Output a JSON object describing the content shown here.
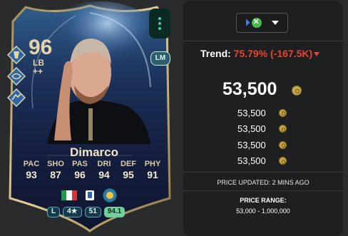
{
  "card": {
    "rating": "96",
    "position": "LB",
    "position_plus": "++",
    "alt_position": "LM",
    "name": "Dimarco",
    "stats": [
      {
        "label": "PAC",
        "value": "93"
      },
      {
        "label": "SHO",
        "value": "87"
      },
      {
        "label": "PAS",
        "value": "96"
      },
      {
        "label": "DRI",
        "value": "94"
      },
      {
        "label": "DEF",
        "value": "95"
      },
      {
        "label": "PHY",
        "value": "91"
      }
    ],
    "pills": {
      "foot": "L",
      "skill": "4★",
      "attr": "51",
      "chem": "94.1"
    },
    "nation_icon": "italy-flag-icon",
    "league_icon": "serie-a-icon",
    "club_icon": "club-crest-icon"
  },
  "panel": {
    "platform_icons": [
      "playstation-icon",
      "xbox-icon"
    ],
    "trend_label": "Trend:",
    "trend_value": "75.79% (-167.5K)",
    "trend_color": "#e8432f",
    "price": "53,500",
    "price_list": [
      "53,500",
      "53,500",
      "53,500",
      "53,500"
    ],
    "updated": "PRICE UPDATED: 2 MINS AGO",
    "range_label": "PRICE RANGE:",
    "range_value": "53,000 - 1,000,000"
  }
}
